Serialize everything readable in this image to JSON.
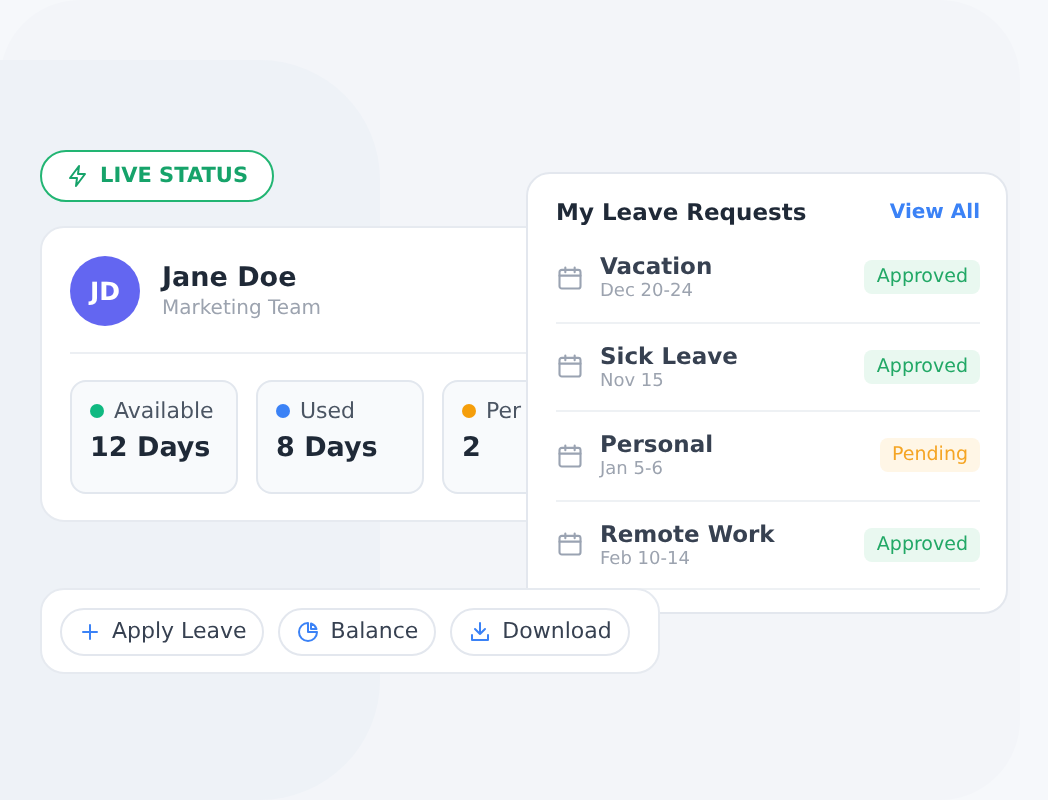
{
  "live_status": {
    "label": "LIVE STATUS"
  },
  "profile": {
    "initials": "JD",
    "name": "Jane Doe",
    "team": "Marketing Team"
  },
  "stats": [
    {
      "label": "Available",
      "value": "12 Days",
      "color": "#10b981"
    },
    {
      "label": "Used",
      "value": "8 Days",
      "color": "#3b82f6"
    },
    {
      "label": "Per",
      "value": "2",
      "color": "#f59e0b"
    }
  ],
  "requests": {
    "title": "My Leave Requests",
    "link": "View All",
    "items": [
      {
        "name": "Vacation",
        "dates": "Dec 20-24",
        "status": "Approved",
        "kind": "approved"
      },
      {
        "name": "Sick Leave",
        "dates": "Nov 15",
        "status": "Approved",
        "kind": "approved"
      },
      {
        "name": "Personal",
        "dates": "Jan 5-6",
        "status": "Pending",
        "kind": "pending"
      },
      {
        "name": "Remote Work",
        "dates": "Feb 10-14",
        "status": "Approved",
        "kind": "approved"
      }
    ]
  },
  "actions": [
    {
      "label": "Apply Leave",
      "kind": "add"
    },
    {
      "label": "Balance",
      "kind": "chart"
    },
    {
      "label": "Download",
      "kind": "download"
    }
  ]
}
